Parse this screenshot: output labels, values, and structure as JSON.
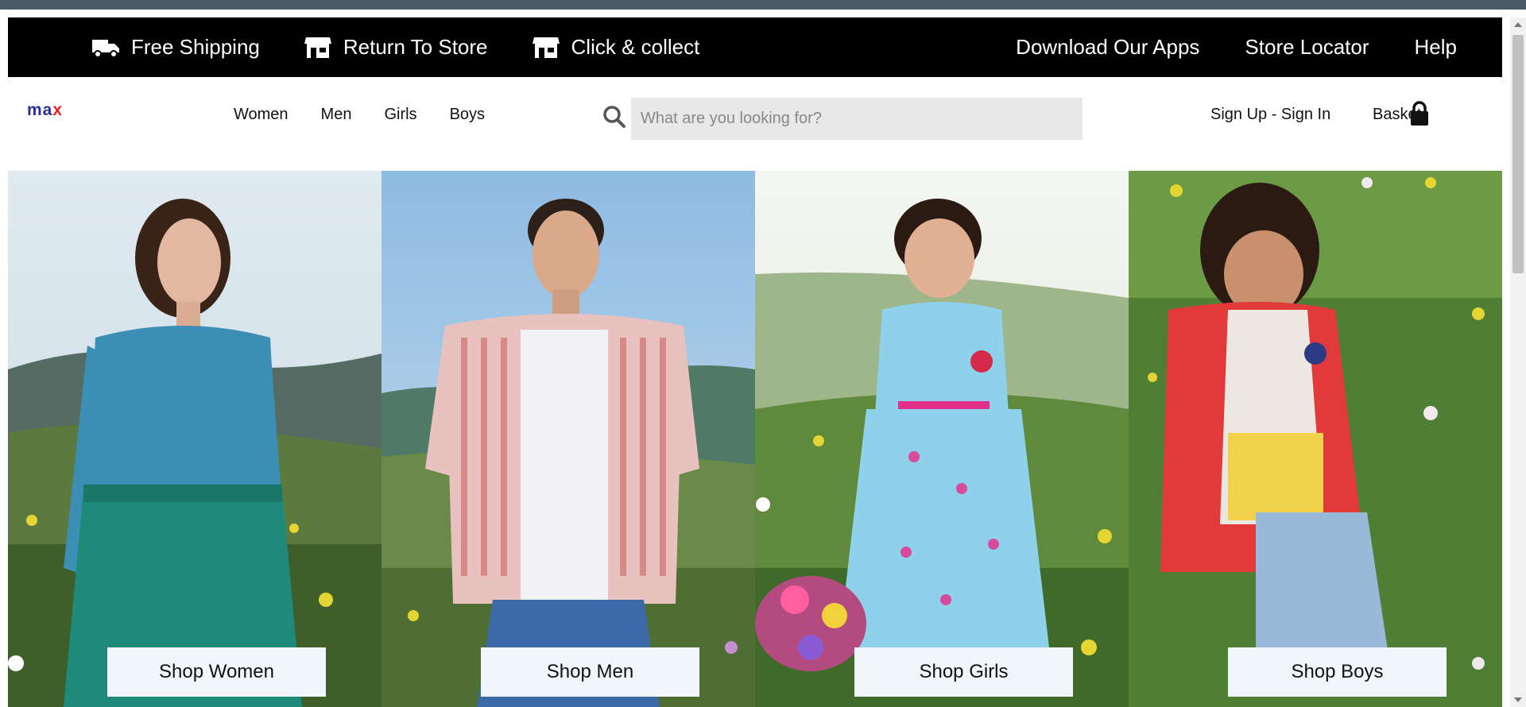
{
  "topbar": {
    "left_items": [
      {
        "label": "Free Shipping",
        "icon": "truck-icon"
      },
      {
        "label": "Return To Store",
        "icon": "store-icon"
      },
      {
        "label": "Click & collect",
        "icon": "store-icon"
      }
    ],
    "right_items": [
      {
        "label": "Download Our Apps"
      },
      {
        "label": "Store Locator"
      },
      {
        "label": "Help"
      }
    ]
  },
  "nav": {
    "logo": {
      "part1": "ma",
      "part2": "x"
    },
    "menu": [
      "Women",
      "Men",
      "Girls",
      "Boys"
    ],
    "search": {
      "placeholder": "What are you looking for?",
      "value": ""
    },
    "signin_label": "Sign Up - Sign In",
    "basket_label": "Basket"
  },
  "hero": {
    "tiles": [
      {
        "button": "Shop Women"
      },
      {
        "button": "Shop Men"
      },
      {
        "button": "Shop Girls"
      },
      {
        "button": "Shop Boys"
      }
    ]
  },
  "colors": {
    "topbar_bg": "#000000",
    "logo_blue": "#2b2f8f",
    "logo_red": "#e4202a",
    "search_bg": "#e8e8e8",
    "button_bg": "#f1f6fa"
  }
}
